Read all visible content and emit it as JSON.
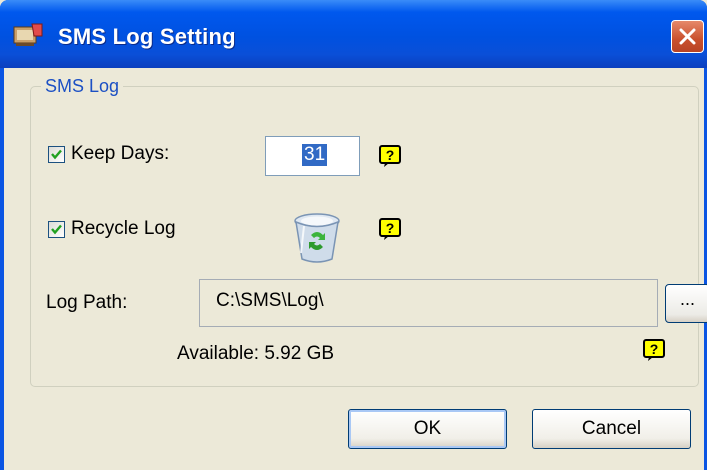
{
  "window": {
    "title": "SMS Log Setting"
  },
  "group": {
    "title": "SMS Log"
  },
  "keep_days": {
    "checked": true,
    "label": "Keep Days:",
    "value": "31"
  },
  "recycle_log": {
    "checked": true,
    "label": "Recycle Log"
  },
  "log_path": {
    "label": "Log Path:",
    "value": "C:\\SMS\\Log\\",
    "browse_label": "..."
  },
  "available": "Available: 5.92 GB",
  "buttons": {
    "ok": "OK",
    "cancel": "Cancel"
  },
  "colors": {
    "titlebar": "#0058ee",
    "face": "#ece9d8",
    "group_title": "#1c50c4",
    "close": "#c9502d",
    "help_bg": "#ffff00",
    "selection": "#316ac5"
  },
  "icons": [
    "app-icon",
    "close-icon",
    "checkmark-icon",
    "help-icon",
    "recycle-bin-icon"
  ]
}
